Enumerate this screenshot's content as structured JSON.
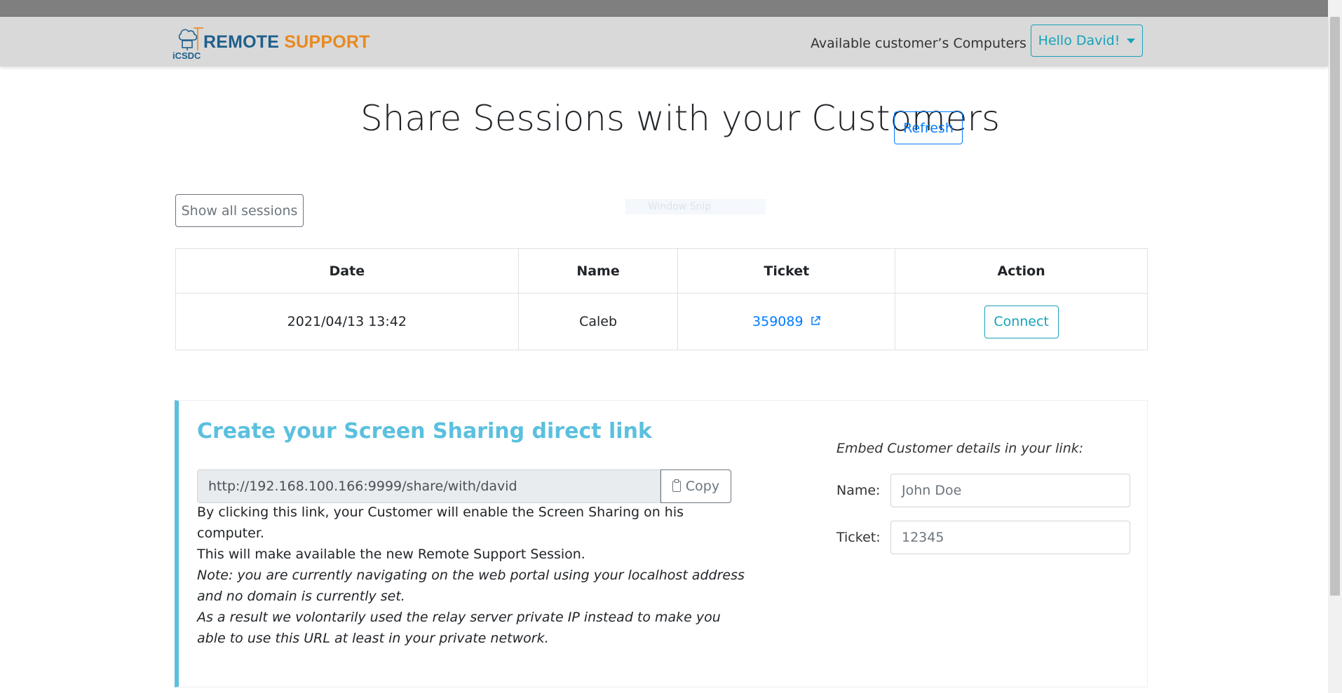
{
  "brand": {
    "word1": "REMOTE",
    "word2": "SUPPORT",
    "logo_text": "iCSDC",
    "colors": {
      "primary": "#1f5f8b",
      "accent": "#e8891f"
    }
  },
  "nav": {
    "link_label": "Available customer’s Computers",
    "user_menu_label": "Hello David!"
  },
  "header": {
    "title": "Share Sessions with your Customers",
    "refresh_label": "Refresh"
  },
  "sessions": {
    "show_all_label": "Show all sessions",
    "ghost_text": "Window Snip",
    "columns": [
      "Date",
      "Name",
      "Ticket",
      "Action"
    ],
    "rows": [
      {
        "date": "2021/04/13 13:42",
        "name": "Caleb",
        "ticket": "359089",
        "action": "Connect"
      }
    ]
  },
  "link_card": {
    "title": "Create your Screen Sharing direct link",
    "url": "http://192.168.100.166:9999/share/with/david",
    "copy_label": "Copy",
    "desc_line1": "By clicking this link, your Customer will enable the Screen Sharing on his computer.",
    "desc_line2": "This will make available the new Remote Support Session.",
    "note_line1": "Note: you are currently navigating on the web portal using your localhost address and no domain is currently set.",
    "note_line2": "As a result we volontarily used the relay server private IP instead to make you able to use this URL at least in your private network.",
    "embed_title": "Embed Customer details in your link:",
    "name_label": "Name:",
    "name_placeholder": "John Doe",
    "ticket_label": "Ticket:",
    "ticket_placeholder": "12345",
    "accent_color": "#5bc0de"
  }
}
